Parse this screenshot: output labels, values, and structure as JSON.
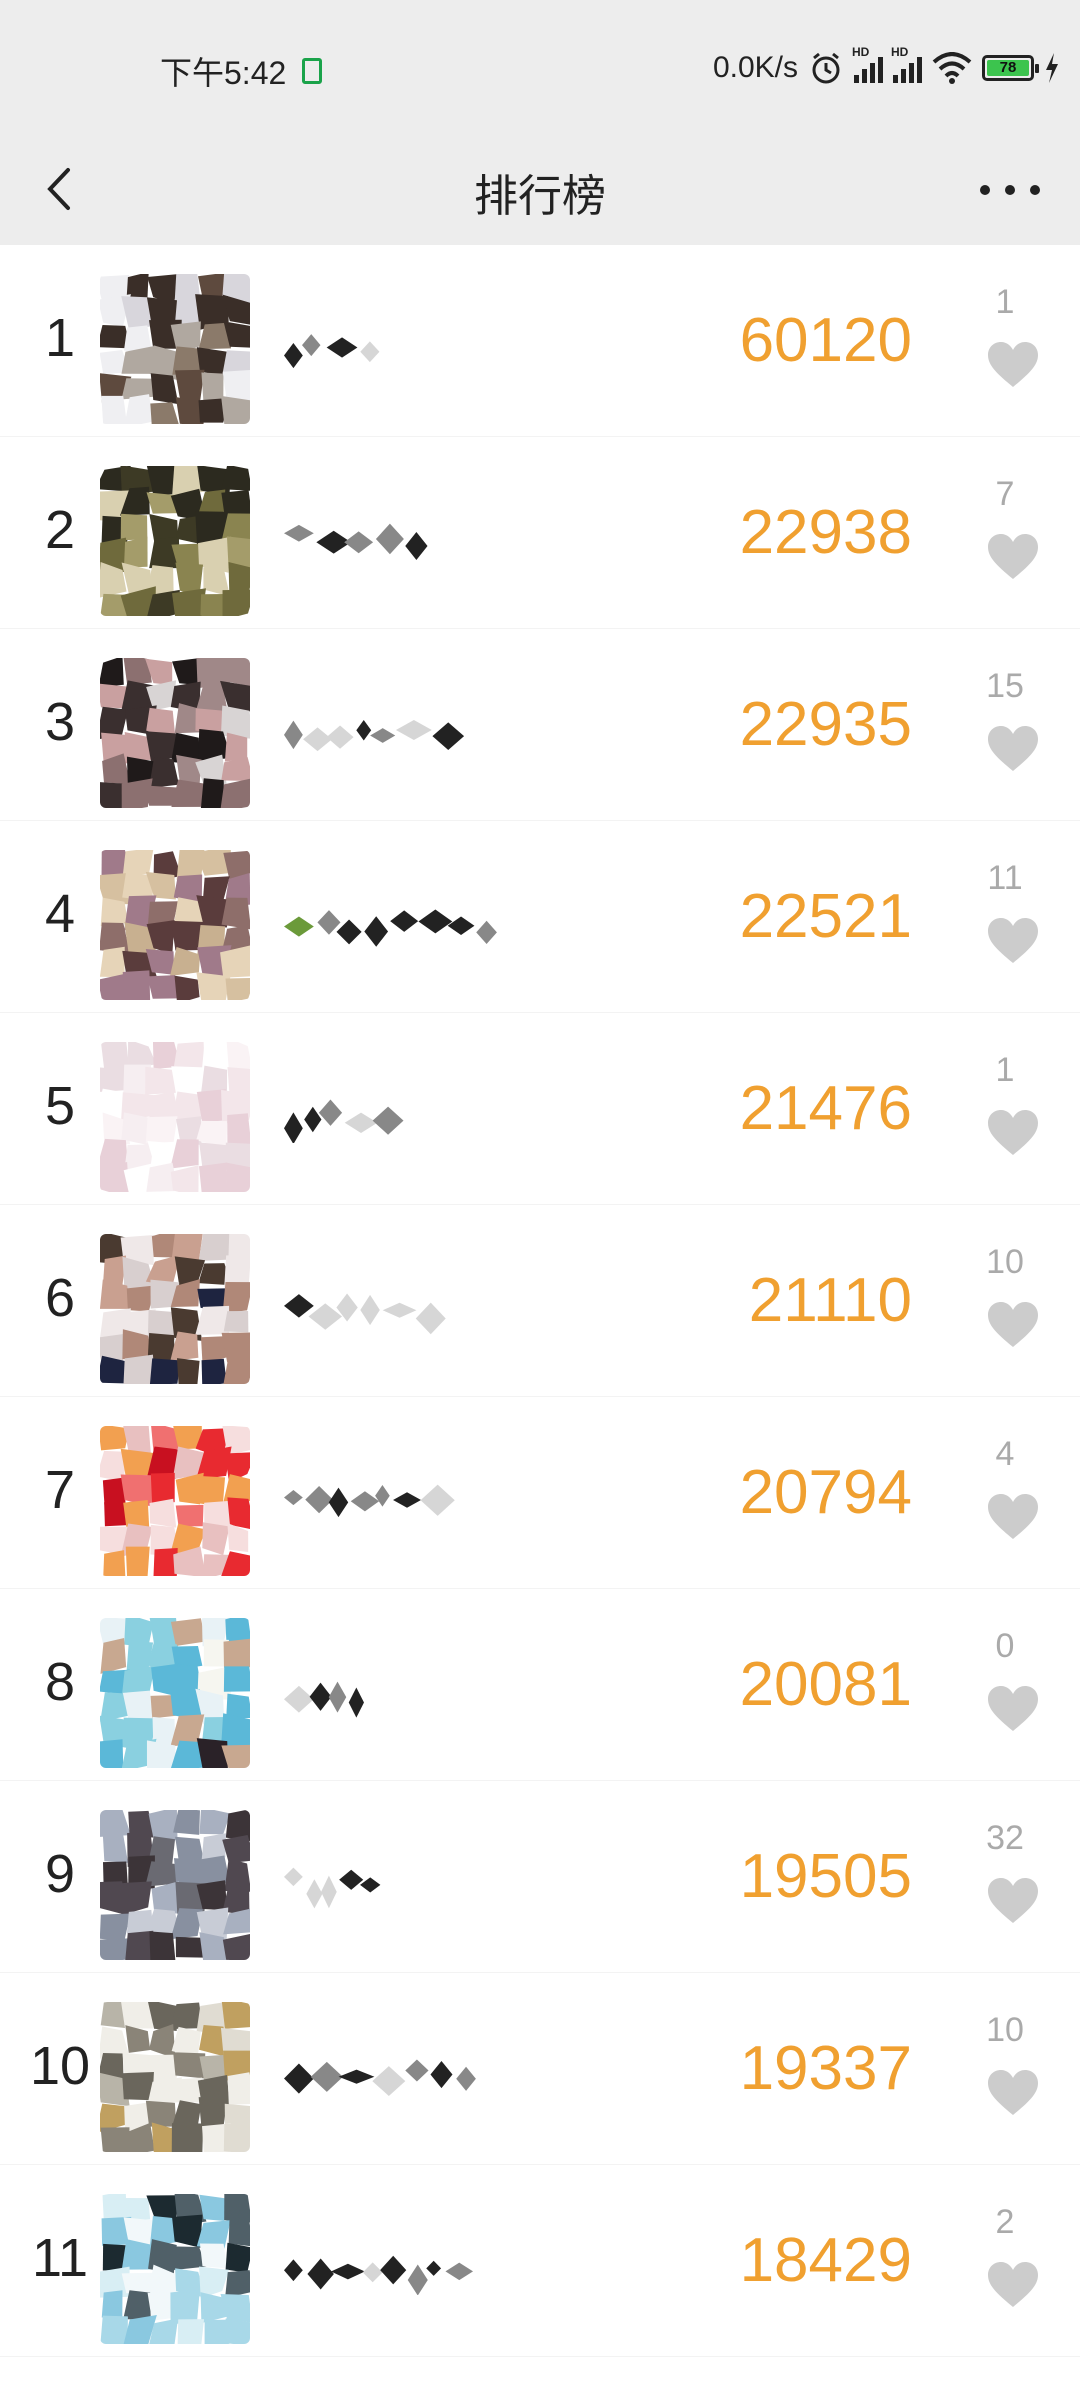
{
  "status_bar": {
    "time": "下午5:42",
    "net_speed": "0.0K/s",
    "battery": "78",
    "icons": [
      "alarm-icon",
      "signal-hd-icon",
      "signal-hd-icon",
      "wifi-icon",
      "battery-icon",
      "charging-icon"
    ]
  },
  "nav": {
    "title": "排行榜",
    "back_icon": "chevron-left-icon",
    "more_icon": "more-horizontal-icon"
  },
  "colors": {
    "score": "#f0a030",
    "like": "#cccccc",
    "bar": "#ededed"
  },
  "rows": [
    {
      "rank": "1",
      "score": "60120",
      "likes": "1",
      "palette": [
        "#8b7a6a",
        "#3a2e28",
        "#d8d6dc",
        "#b0a8a0",
        "#5e4a3e",
        "#efeff2"
      ]
    },
    {
      "rank": "2",
      "score": "22938",
      "likes": "7",
      "palette": [
        "#6f6a3c",
        "#3d3a25",
        "#a49c6a",
        "#d9d0b0",
        "#2c2a1f",
        "#8a8450"
      ]
    },
    {
      "rank": "3",
      "score": "22935",
      "likes": "15",
      "palette": [
        "#3a2f2f",
        "#c9a0a0",
        "#8c7070",
        "#d8d4d4",
        "#1f1a1a",
        "#a08888"
      ]
    },
    {
      "rank": "4",
      "score": "22521",
      "likes": "11",
      "palette": [
        "#c8b090",
        "#8e6e6a",
        "#e6d4b8",
        "#a07a8a",
        "#5a3c3c",
        "#d6c0a0"
      ]
    },
    {
      "rank": "5",
      "score": "21476",
      "likes": "1",
      "palette": [
        "#f3e6ea",
        "#e8d0d8",
        "#faf3f5",
        "#eadde2",
        "#f6eef1",
        "#ffffff"
      ]
    },
    {
      "rank": "6",
      "score": "21110",
      "likes": "10",
      "palette": [
        "#d8cfcf",
        "#c9a090",
        "#4a3a30",
        "#efe8e8",
        "#b08878",
        "#1e2440"
      ]
    },
    {
      "rank": "7",
      "score": "20794",
      "likes": "4",
      "palette": [
        "#e82a30",
        "#f07070",
        "#f2a050",
        "#c81020",
        "#e8c0c0",
        "#f6dede"
      ]
    },
    {
      "rank": "8",
      "score": "20081",
      "likes": "0",
      "palette": [
        "#5bb8d8",
        "#e8f2f6",
        "#2a2228",
        "#c8a890",
        "#8ad0e0",
        "#f6f6f0"
      ]
    },
    {
      "rank": "9",
      "score": "19505",
      "likes": "32",
      "palette": [
        "#6a6a72",
        "#a8b0c0",
        "#3c3438",
        "#8890a0",
        "#c8ccd6",
        "#504850"
      ]
    },
    {
      "rank": "10",
      "score": "19337",
      "likes": "10",
      "palette": [
        "#b8b4a8",
        "#8a8478",
        "#e0dcd2",
        "#c0a060",
        "#6a665c",
        "#f0eee8"
      ]
    },
    {
      "rank": "11",
      "score": "18429",
      "likes": "2",
      "palette": [
        "#d8eef4",
        "#1c2a30",
        "#8ac8e0",
        "#f2f8fa",
        "#a8d8e8",
        "#506068"
      ]
    }
  ]
}
